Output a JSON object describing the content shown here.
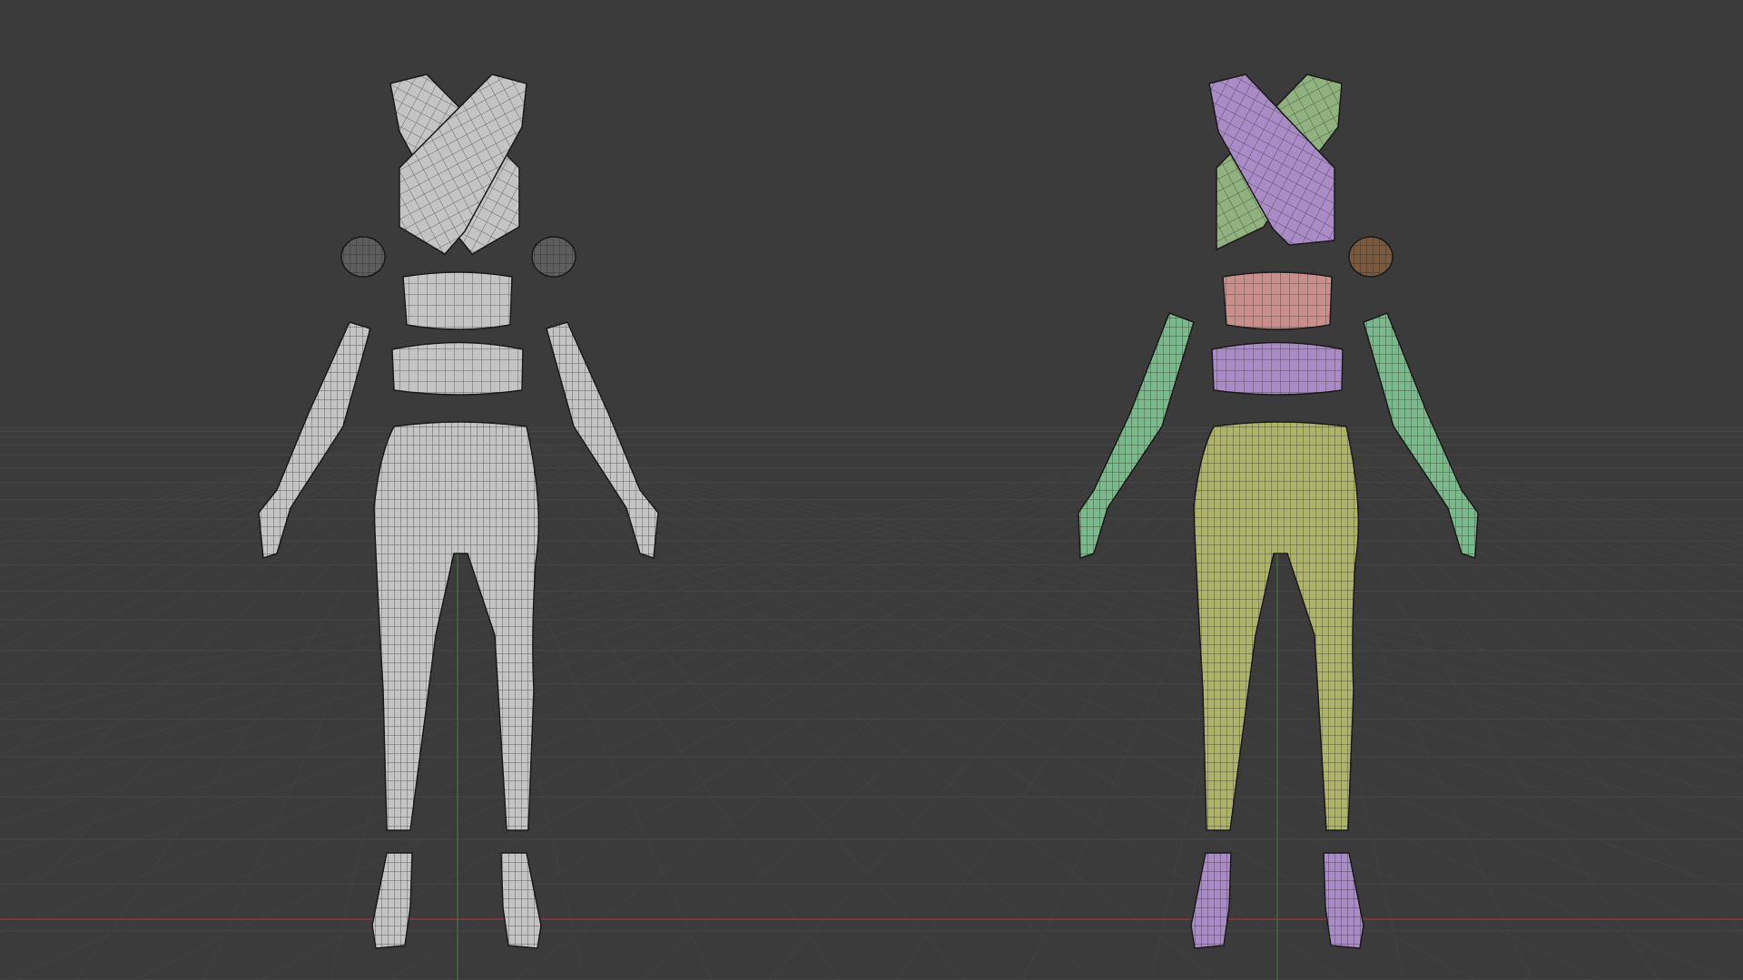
{
  "viewport": {
    "background": "#3b3b3b",
    "grid_color": "#444444",
    "x_axis_color": "#8a3a3a",
    "y_axis_color": "#3f6a3a"
  },
  "models": [
    {
      "id": "left-model",
      "shading": "solid-wireframe",
      "parts": [
        {
          "part": "crop-top-wrap",
          "color": "#c4c4c4"
        },
        {
          "part": "wrist-cuff-left",
          "color": "#5e5e5e"
        },
        {
          "part": "wrist-cuff-right",
          "color": "#5e5e5e"
        },
        {
          "part": "bandeau",
          "color": "#c4c4c4"
        },
        {
          "part": "waistband",
          "color": "#c4c4c4"
        },
        {
          "part": "glove-left",
          "color": "#c4c4c4"
        },
        {
          "part": "glove-right",
          "color": "#c4c4c4"
        },
        {
          "part": "leggings",
          "color": "#c4c4c4"
        },
        {
          "part": "boot-left",
          "color": "#c4c4c4"
        },
        {
          "part": "boot-right",
          "color": "#c4c4c4"
        }
      ]
    },
    {
      "id": "right-model",
      "shading": "colored-wireframe",
      "parts": [
        {
          "part": "crop-top-wrap-front",
          "color": "#a98bc6"
        },
        {
          "part": "crop-top-wrap-back",
          "color": "#8fb27f"
        },
        {
          "part": "wrist-cuff-right",
          "color": "#7a5a3c"
        },
        {
          "part": "bandeau",
          "color": "#c98f8a"
        },
        {
          "part": "waistband",
          "color": "#a98bc6"
        },
        {
          "part": "glove-left",
          "color": "#79b98a"
        },
        {
          "part": "glove-right",
          "color": "#79b98a"
        },
        {
          "part": "leggings",
          "color": "#aeb36a"
        },
        {
          "part": "boot-left",
          "color": "#a98bc6"
        },
        {
          "part": "boot-right",
          "color": "#a98bc6"
        }
      ]
    }
  ]
}
